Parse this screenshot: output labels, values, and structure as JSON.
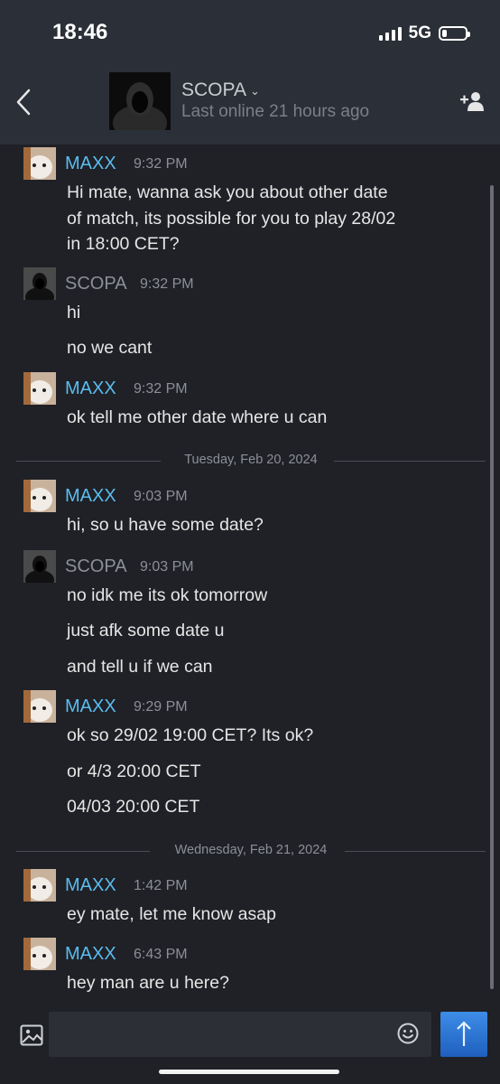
{
  "status_bar": {
    "time": "18:46",
    "network": "5G"
  },
  "header": {
    "contact_name": "SCOPA",
    "last_online": "Last online 21 hours ago"
  },
  "messages": [
    {
      "sender": "MAXX",
      "time": "9:32 PM",
      "lines": [
        "Hi mate, wanna ask you about other date",
        "of match, its possible for you to play 28/02",
        "in 18:00 CET?"
      ]
    },
    {
      "sender": "SCOPA",
      "time": "9:32 PM",
      "lines": [
        "hi",
        "no we cant"
      ]
    },
    {
      "sender": "MAXX",
      "time": "9:32 PM",
      "lines": [
        "ok tell me other date where u can"
      ]
    },
    {
      "sender": "MAXX",
      "time": "9:03 PM",
      "lines": [
        "hi, so u have some date?"
      ]
    },
    {
      "sender": "SCOPA",
      "time": "9:03 PM",
      "lines": [
        "no idk me its ok tomorrow",
        "just afk some date u",
        "and tell u if we can"
      ]
    },
    {
      "sender": "MAXX",
      "time": "9:29 PM",
      "lines": [
        "ok so 29/02 19:00 CET? Its ok?",
        "or 4/3 20:00 CET",
        "04/03 20:00 CET"
      ]
    },
    {
      "sender": "MAXX",
      "time": "1:42 PM",
      "lines": [
        "ey mate, let me know asap"
      ]
    },
    {
      "sender": "MAXX",
      "time": "6:43 PM",
      "lines": [
        "hey man are u here?"
      ]
    }
  ],
  "dividers": [
    "Tuesday, Feb 20, 2024",
    "Wednesday, Feb 21, 2024"
  ],
  "colors": {
    "sender_self": "#5bbcf0",
    "sender_other": "#8c8f96",
    "send_button": "#2f7ad6",
    "background": "#1f2126"
  },
  "icons": {
    "back": "chevron-left-icon",
    "add_friend": "add-user-icon",
    "image": "image-icon",
    "emoji": "smiley-icon",
    "send": "arrow-up-icon"
  }
}
